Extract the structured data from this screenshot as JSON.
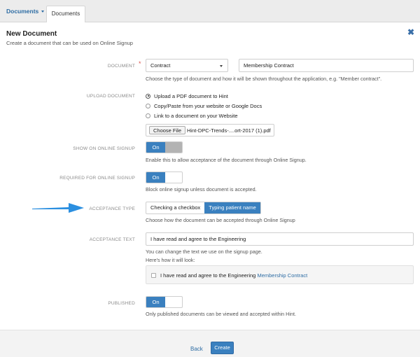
{
  "tabs": {
    "dropdown_label": "Documents",
    "active_label": "Documents"
  },
  "header": {
    "title": "New Document",
    "subtitle": "Create a document that can be used on Online Signup"
  },
  "form": {
    "document": {
      "label": "DOCUMENT",
      "required_mark": "*",
      "type_value": "Contract",
      "name_value": "Membership Contract",
      "help": "Choose the type of document and how it will be shown throughout the application, e.g. \"Member contract\"."
    },
    "upload": {
      "label": "UPLOAD DOCUMENT",
      "options": [
        "Upload a PDF document to Hint",
        "Copy/Paste from your website or Google Docs",
        "Link to a document on your Website"
      ],
      "selected_index": 0,
      "choose_file_label": "Choose File",
      "file_name": "Hint-DPC-Trends-....ort-2017 (1).pdf"
    },
    "show_online": {
      "label": "SHOW ON ONLINE SIGNUP",
      "toggle": "On",
      "help": "Enable this to allow acceptance of the document through Online Signup."
    },
    "required_online": {
      "label": "REQUIRED FOR ONLINE SIGNUP",
      "toggle": "On",
      "help": "Block online signup unless document is accepted."
    },
    "acceptance_type": {
      "label": "ACCEPTANCE TYPE",
      "options": [
        "Checking a checkbox",
        "Typing patient name"
      ],
      "selected_index": 1,
      "help": "Choose how the document can be accepted through Online Signup"
    },
    "acceptance_text": {
      "label": "ACCEPTANCE TEXT",
      "value": "I have read and agree to the Engineering",
      "help1": "You can change the text we use on the signup page.",
      "help2": "Here's how it will look:",
      "preview_text": "I have read and agree to the Engineering",
      "preview_link": "Membership Contract"
    },
    "published": {
      "label": "PUBLISHED",
      "toggle": "On",
      "help": "Only published documents can be viewed and accepted within Hint."
    }
  },
  "footer": {
    "back_label": "Back",
    "create_label": "Create"
  },
  "colors": {
    "accent": "#3a80bf",
    "link": "#2e6da4",
    "required": "#d9534f",
    "arrow": "#2b8fe0"
  }
}
